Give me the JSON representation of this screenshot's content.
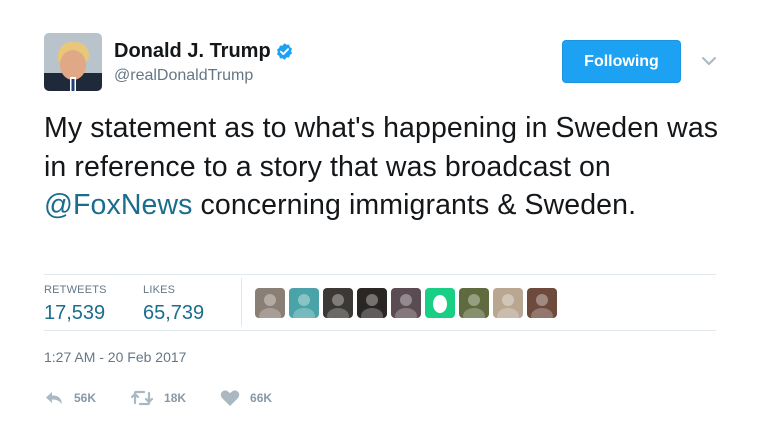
{
  "author": {
    "display_name": "Donald J. Trump",
    "handle": "@realDonaldTrump",
    "verified": true
  },
  "follow_button": {
    "label": "Following"
  },
  "tweet": {
    "text_before": "My statement as to what's happening in Sweden was in reference to a story that was broadcast on ",
    "mention": "@FoxNews",
    "text_after": " concerning immigrants & Sweden."
  },
  "stats": {
    "retweets_label": "RETWEETS",
    "retweets_value": "17,539",
    "likes_label": "LIKES",
    "likes_value": "65,739"
  },
  "likers": [
    {
      "icon": "user-avatar",
      "color": "#8a7f74"
    },
    {
      "icon": "user-avatar",
      "color": "#4aa3a8"
    },
    {
      "icon": "user-avatar",
      "color": "#3b3835"
    },
    {
      "icon": "user-avatar",
      "color": "#2a2624"
    },
    {
      "icon": "user-avatar",
      "color": "#5b4b52"
    },
    {
      "icon": "egg-avatar",
      "color": "#19cf86"
    },
    {
      "icon": "user-avatar",
      "color": "#5f6b3e"
    },
    {
      "icon": "user-avatar",
      "color": "#b9a792"
    },
    {
      "icon": "user-avatar",
      "color": "#6e4a3c"
    }
  ],
  "timestamp": "1:27 AM - 20 Feb 2017",
  "actions": {
    "reply_count": "56K",
    "retweet_count": "18K",
    "like_count": "66K"
  },
  "colors": {
    "accent": "#1da1f2",
    "mention": "#1b6d8d",
    "muted": "#657786",
    "icon": "#aab8c2"
  }
}
